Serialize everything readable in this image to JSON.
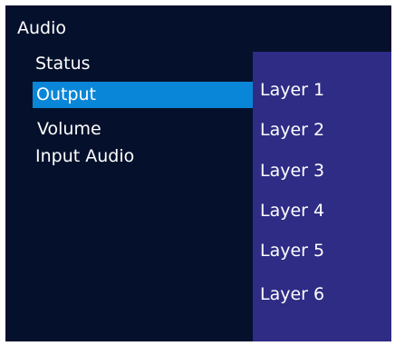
{
  "menu": {
    "title": "Audio",
    "items": [
      {
        "label": "Status",
        "selected": false
      },
      {
        "label": "Output",
        "selected": true
      },
      {
        "label": "Volume",
        "selected": false
      },
      {
        "label": "Input Audio",
        "selected": false
      }
    ]
  },
  "submenu": {
    "items": [
      {
        "label": "Layer 1"
      },
      {
        "label": "Layer 2"
      },
      {
        "label": "Layer 3"
      },
      {
        "label": "Layer 4"
      },
      {
        "label": "Layer 5"
      },
      {
        "label": "Layer 6"
      }
    ]
  },
  "colors": {
    "panel_background": "#05112c",
    "selection_highlight": "#0a86d8",
    "submenu_background": "#2f2c86",
    "text": "#ffffff"
  }
}
